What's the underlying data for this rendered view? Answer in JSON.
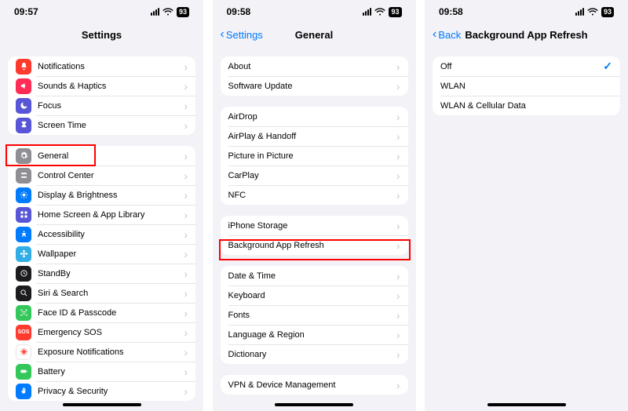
{
  "screens": [
    {
      "time": "09:57",
      "battery": "93",
      "nav": {
        "title": "Settings",
        "back": null
      },
      "groups": [
        {
          "rows": [
            {
              "icon": "bell",
              "color": "bg-red",
              "label": "Notifications"
            },
            {
              "icon": "speaker",
              "color": "bg-pink",
              "label": "Sounds & Haptics"
            },
            {
              "icon": "moon",
              "color": "bg-purple",
              "label": "Focus"
            },
            {
              "icon": "hourglass",
              "color": "bg-purple",
              "label": "Screen Time"
            }
          ]
        },
        {
          "rows": [
            {
              "icon": "gear",
              "color": "bg-gray",
              "label": "General"
            },
            {
              "icon": "switches",
              "color": "bg-gray",
              "label": "Control Center"
            },
            {
              "icon": "sun",
              "color": "bg-blue",
              "label": "Display & Brightness"
            },
            {
              "icon": "grid",
              "color": "bg-purple",
              "label": "Home Screen & App Library"
            },
            {
              "icon": "person",
              "color": "bg-blue",
              "label": "Accessibility"
            },
            {
              "icon": "flower",
              "color": "bg-cyan",
              "label": "Wallpaper"
            },
            {
              "icon": "clock",
              "color": "bg-black",
              "label": "StandBy"
            },
            {
              "icon": "search",
              "color": "bg-black",
              "label": "Siri & Search"
            },
            {
              "icon": "faceid",
              "color": "bg-green",
              "label": "Face ID & Passcode"
            },
            {
              "icon": "sos",
              "color": "bg-sos",
              "label": "Emergency SOS"
            },
            {
              "icon": "virus",
              "color": "bg-white",
              "label": "Exposure Notifications"
            },
            {
              "icon": "battery",
              "color": "bg-green",
              "label": "Battery"
            },
            {
              "icon": "hand",
              "color": "bg-blue",
              "label": "Privacy & Security"
            }
          ]
        }
      ]
    },
    {
      "time": "09:58",
      "battery": "93",
      "nav": {
        "title": "General",
        "back": "Settings"
      },
      "groups": [
        {
          "rows": [
            {
              "label": "About"
            },
            {
              "label": "Software Update"
            }
          ]
        },
        {
          "rows": [
            {
              "label": "AirDrop"
            },
            {
              "label": "AirPlay & Handoff"
            },
            {
              "label": "Picture in Picture"
            },
            {
              "label": "CarPlay"
            },
            {
              "label": "NFC"
            }
          ]
        },
        {
          "rows": [
            {
              "label": "iPhone Storage"
            },
            {
              "label": "Background App Refresh"
            }
          ]
        },
        {
          "rows": [
            {
              "label": "Date & Time"
            },
            {
              "label": "Keyboard"
            },
            {
              "label": "Fonts"
            },
            {
              "label": "Language & Region"
            },
            {
              "label": "Dictionary"
            }
          ]
        },
        {
          "rows": [
            {
              "label": "VPN & Device Management"
            }
          ]
        }
      ]
    },
    {
      "time": "09:58",
      "battery": "93",
      "nav": {
        "title": "Background App Refresh",
        "back": "Back"
      },
      "groups": [
        {
          "rows": [
            {
              "label": "Off",
              "selected": true
            },
            {
              "label": "WLAN"
            },
            {
              "label": "WLAN & Cellular Data"
            }
          ]
        }
      ]
    }
  ]
}
